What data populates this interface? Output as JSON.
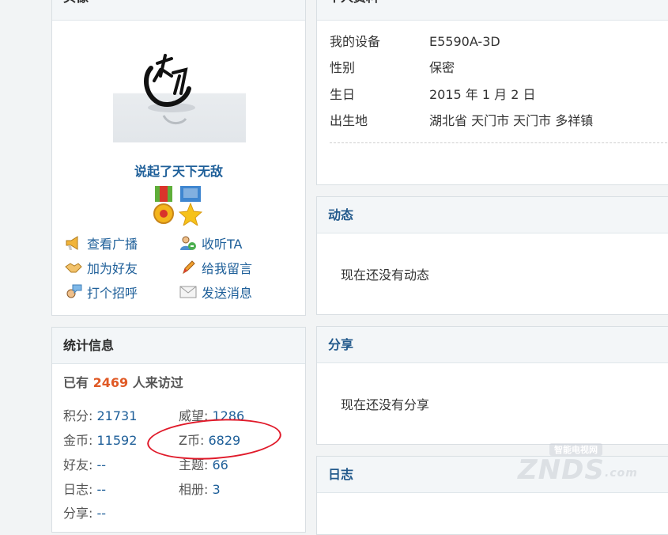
{
  "avatar_panel": {
    "title": "头像",
    "username": "说起了天下无敌",
    "actions": [
      {
        "label": "查看广播",
        "icon": "megaphone-icon"
      },
      {
        "label": "收听TA",
        "icon": "follow-user-icon"
      },
      {
        "label": "加为好友",
        "icon": "handshake-icon"
      },
      {
        "label": "给我留言",
        "icon": "pencil-icon"
      },
      {
        "label": "打个招呼",
        "icon": "greet-chat-icon"
      },
      {
        "label": "发送消息",
        "icon": "envelope-icon"
      }
    ]
  },
  "profile_panel": {
    "title": "个人资料",
    "rows": [
      {
        "key": "我的设备",
        "value": "E5590A-3D"
      },
      {
        "key": "性别",
        "value": "保密"
      },
      {
        "key": "生日",
        "value": "2015 年 1 月 2 日"
      },
      {
        "key": "出生地",
        "value": "湖北省 天门市 天门市 多祥镇"
      }
    ]
  },
  "feed_panel": {
    "title": "动态",
    "empty": "现在还没有动态"
  },
  "share_panel": {
    "title": "分享",
    "empty": "现在还没有分享"
  },
  "blog_panel": {
    "title": "日志"
  },
  "stats_panel": {
    "title": "统计信息",
    "visits_prefix": "已有",
    "visits_count": "2469",
    "visits_suffix": "人来访过",
    "items": [
      {
        "label": "积分: ",
        "value": "21731"
      },
      {
        "label": "威望: ",
        "value": "1286"
      },
      {
        "label": "金币: ",
        "value": "11592"
      },
      {
        "label": "Z币: ",
        "value": "6829"
      },
      {
        "label": "好友: ",
        "value": "--"
      },
      {
        "label": "主题: ",
        "value": "66"
      },
      {
        "label": "日志: ",
        "value": "--"
      },
      {
        "label": "相册: ",
        "value": "3"
      },
      {
        "label": "分享: ",
        "value": "--"
      }
    ]
  },
  "watermark": {
    "text": "ZNDS",
    "subtext": "智能电视网",
    "suffix": ".com"
  },
  "colors": {
    "accent": "#1e5f99",
    "visits": "#e05a26",
    "annotation": "#e01a2a"
  }
}
